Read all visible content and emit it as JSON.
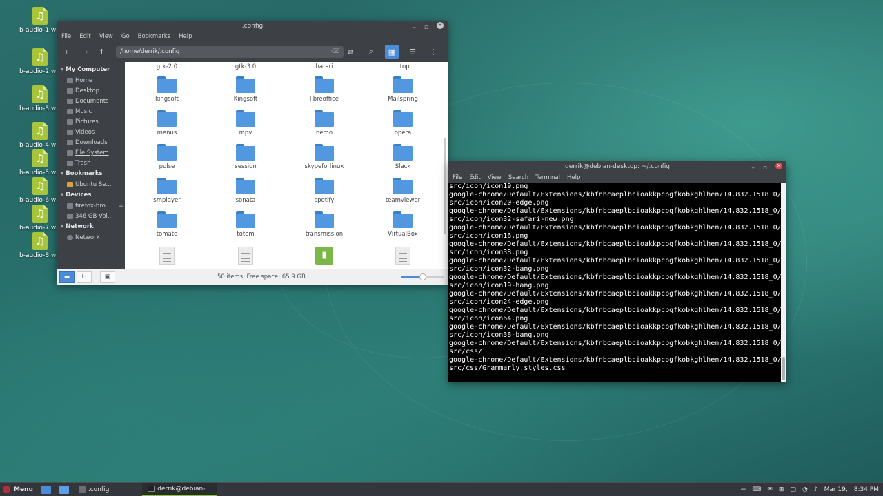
{
  "desktop": {
    "icons": [
      {
        "label": "b-audio-1.wa"
      },
      {
        "label": "b-audio-2.wa"
      },
      {
        "label": "b-audio-3.wa"
      },
      {
        "label": "b-audio-4.wa"
      },
      {
        "label": "b-audio-5.wa"
      },
      {
        "label": "b-audio-6.wa"
      },
      {
        "label": "b-audio-7.wa"
      },
      {
        "label": "b-audio-8.wa"
      }
    ]
  },
  "file_manager": {
    "title": ".config",
    "menu": [
      "File",
      "Edit",
      "View",
      "Go",
      "Bookmarks",
      "Help"
    ],
    "path": "/home/derrik/.config",
    "sidebar": {
      "my_computer": "My Computer",
      "places": [
        "Home",
        "Desktop",
        "Documents",
        "Music",
        "Pictures",
        "Videos",
        "Downloads",
        "File System",
        "Trash"
      ],
      "bookmarks_head": "Bookmarks",
      "bookmarks": [
        "Ubuntu Se..."
      ],
      "devices_head": "Devices",
      "devices": [
        "firefox-bro...",
        "346 GB Vol..."
      ],
      "network_head": "Network",
      "network": [
        "Network"
      ]
    },
    "items": [
      [
        "gtk-2.0",
        "gtk-3.0",
        "hatari",
        "htop"
      ],
      [
        "kingsoft",
        "Kingsoft",
        "libreoffice",
        "Mailspring"
      ],
      [
        "menus",
        "mpv",
        "nemo",
        "opera"
      ],
      [
        "pulse",
        "session",
        "skypeforlinux",
        "Slack"
      ],
      [
        "smplayer",
        "sonata",
        "spotify",
        "teamviewer"
      ],
      [
        "tomate",
        "totem",
        "transmission",
        "VirtualBox"
      ]
    ],
    "status": "50 items, Free space: 65.9 GB",
    "zoom_level": 0.5
  },
  "terminal": {
    "title": "derrik@debian-desktop: ~/.config",
    "menu": [
      "File",
      "Edit",
      "View",
      "Search",
      "Terminal",
      "Help"
    ],
    "lines": [
      "src/icon/icon19.png",
      "google-chrome/Default/Extensions/kbfnbcaeplbcioakkpcpgfkobkghlhen/14.832.1518_0/",
      "src/icon/icon20-edge.png",
      "google-chrome/Default/Extensions/kbfnbcaeplbcioakkpcpgfkobkghlhen/14.832.1518_0/",
      "src/icon/icon32-safari-new.png",
      "google-chrome/Default/Extensions/kbfnbcaeplbcioakkpcpgfkobkghlhen/14.832.1518_0/",
      "src/icon/icon16.png",
      "google-chrome/Default/Extensions/kbfnbcaeplbcioakkpcpgfkobkghlhen/14.832.1518_0/",
      "src/icon/icon38.png",
      "google-chrome/Default/Extensions/kbfnbcaeplbcioakkpcpgfkobkghlhen/14.832.1518_0/",
      "src/icon/icon32-bang.png",
      "google-chrome/Default/Extensions/kbfnbcaeplbcioakkpcpgfkobkghlhen/14.832.1518_0/",
      "src/icon/icon19-bang.png",
      "google-chrome/Default/Extensions/kbfnbcaeplbcioakkpcpgfkobkghlhen/14.832.1518_0/",
      "src/icon/icon24-edge.png",
      "google-chrome/Default/Extensions/kbfnbcaeplbcioakkpcpgfkobkghlhen/14.832.1518_0/",
      "src/icon/icon64.png",
      "google-chrome/Default/Extensions/kbfnbcaeplbcioakkpcpgfkobkghlhen/14.832.1518_0/",
      "src/icon/icon38-bang.png",
      "google-chrome/Default/Extensions/kbfnbcaeplbcioakkpcpgfkobkghlhen/14.832.1518_0/",
      "src/css/",
      "google-chrome/Default/Extensions/kbfnbcaeplbcioakkpcpgfkobkghlhen/14.832.1518_0/",
      "src/css/Grammarly.styles.css"
    ]
  },
  "taskbar": {
    "menu_label": "Menu",
    "tasks": [
      ".config",
      "derrik@debian-..."
    ],
    "date": "Mar 19,",
    "time": "8:34 PM"
  },
  "colors": {
    "accent": "#4b8bd8",
    "folder": "#5298e0",
    "audio_file": "#a7c43a",
    "terminal_close": "#e0474a"
  }
}
